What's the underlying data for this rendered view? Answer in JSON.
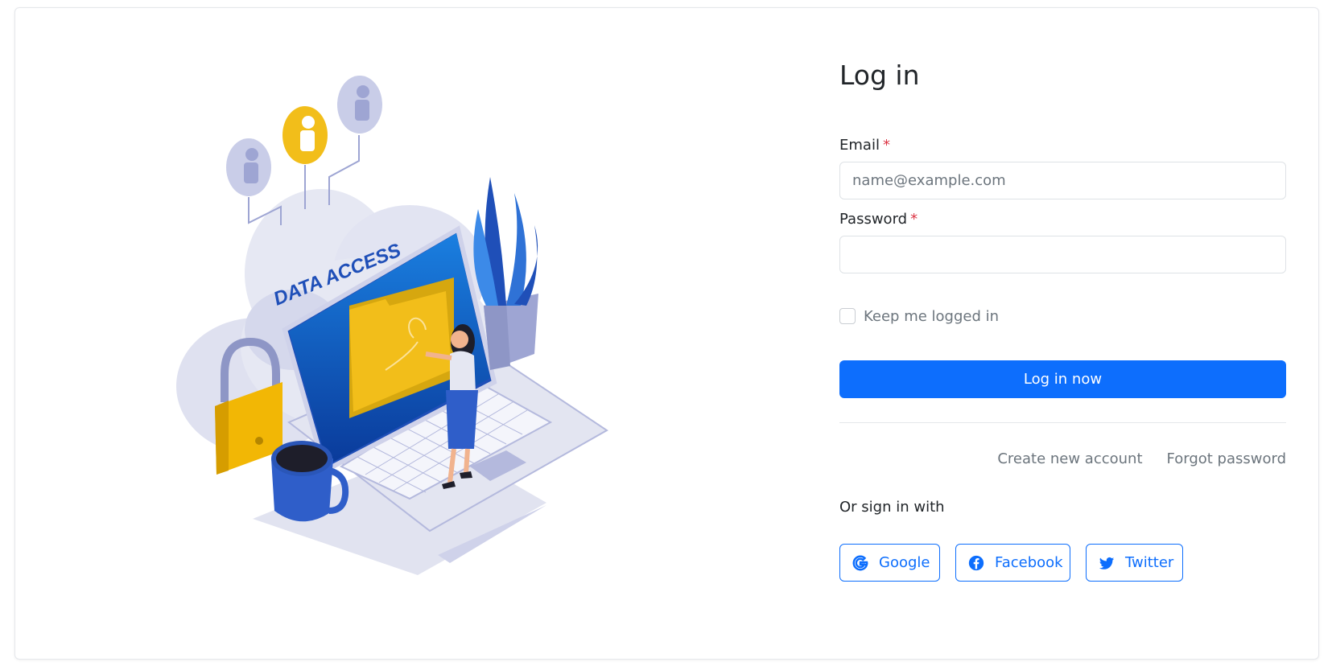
{
  "illustration": {
    "banner_text": "DATA ACCESS",
    "alt": "data-access-illustration"
  },
  "form": {
    "title": "Log in",
    "email": {
      "label": "Email",
      "required_mark": "*",
      "placeholder": "name@example.com",
      "value": ""
    },
    "password": {
      "label": "Password",
      "required_mark": "*",
      "value": ""
    },
    "remember": {
      "label": "Keep me logged in",
      "checked": false
    },
    "submit_label": "Log in now",
    "links": {
      "create_account": "Create new account",
      "forgot_password": "Forgot password"
    },
    "social": {
      "heading": "Or sign in with",
      "buttons": [
        {
          "label": "Google",
          "icon": "google-icon"
        },
        {
          "label": "Facebook",
          "icon": "facebook-icon"
        },
        {
          "label": "Twitter",
          "icon": "twitter-icon"
        }
      ]
    }
  },
  "colors": {
    "primary": "#0d6efd",
    "required": "#dc3545",
    "muted_text": "#6c757d",
    "illustration_blue": "#1f4fb8",
    "illustration_yellow": "#f2be1a",
    "illustration_lavender": "#c9cde8"
  }
}
